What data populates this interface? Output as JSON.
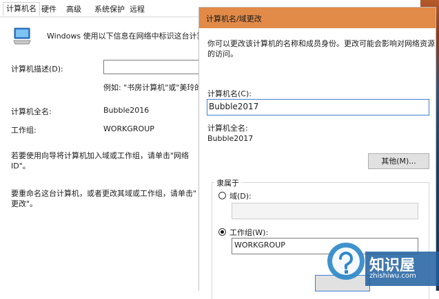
{
  "tabs": [
    "计算机名",
    "硬件",
    "高级",
    "系统保护",
    "远程"
  ],
  "computer_name_tab": {
    "intro": "Windows 使用以下信息在网络中标识这台计算",
    "description_label": "计算机描述(D):",
    "description_value": "",
    "example": "例如: \"书房计算机\"或\"美玲的",
    "full_name_label": "计算机全名:",
    "full_name_value": "Bubble2016",
    "workgroup_label": "工作组:",
    "workgroup_value": "WORKGROUP",
    "wizard_text_1": "若要使用向导将计算机加入域或工作组，请单击\"网络",
    "wizard_text_2": "ID\"。",
    "rename_text_1": "要重命名这台计算机，或者更改其域或工作组，请单击\"",
    "rename_text_2": "更改\"。"
  },
  "dialog": {
    "title": "计算机名/域更改",
    "desc_1": "你可以更改该计算机的名称和成员身份。更改可能会影响对网络资源",
    "desc_2": "的访问。",
    "name_label": "计算机名(C):",
    "name_value": "Bubble2017",
    "full_name_label": "计算机全名:",
    "full_name_value": "Bubble2017",
    "more_button": "其他(M)...",
    "member_of_label": "隶属于",
    "domain_label": "域(D):",
    "domain_value": "",
    "workgroup_label": "工作组(W):",
    "workgroup_value": "WORKGROUP",
    "selected_option": "workgroup"
  },
  "watermark": {
    "brand": "知识屋",
    "site": "zhishiwu.com"
  }
}
